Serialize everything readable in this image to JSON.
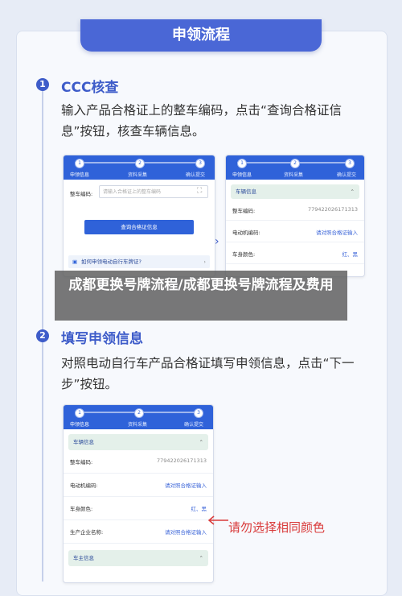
{
  "header": {
    "title": "申领流程"
  },
  "steps": [
    {
      "num": "1",
      "title": "CCC核查",
      "desc": "输入产品合格证上的整车编码，点击“查询合格证信息”按钮，核查车辆信息。"
    },
    {
      "num": "2",
      "title": "填写申领信息",
      "desc": "对照电动自行车产品合格证填写申领信息，点击“下一步”按钮。"
    }
  ],
  "progress_labels": [
    "申领信息",
    "资料采集",
    "确认提交"
  ],
  "progress_nums": [
    "1",
    "2",
    "3"
  ],
  "screen1": {
    "vin_label": "整车编码:",
    "vin_placeholder": "请输入合格证上的整车编码",
    "query_button": "查询合格证信息",
    "help_link": "如何申领电动自行车牌证?"
  },
  "screen2": {
    "section_vehicle": "车辆信息",
    "rows": [
      {
        "k": "整车编码:",
        "v": "779422026171313"
      },
      {
        "k": "电动机编码:",
        "v": "请对照合格证输入"
      },
      {
        "k": "车身颜色:",
        "v": "红、黑"
      }
    ]
  },
  "screen3": {
    "section_vehicle": "车辆信息",
    "rows": [
      {
        "k": "整车编码:",
        "v": "779422026171313"
      },
      {
        "k": "电动机编码:",
        "v": "请对照合格证输入"
      },
      {
        "k": "车身颜色:",
        "v": "红、黑"
      },
      {
        "k": "生产企业名称:",
        "v": "请对照合格证输入"
      }
    ],
    "section_owner": "车主信息"
  },
  "overlay_title": "成都更换号牌流程/成都更换号牌流程及费用",
  "annotation": "请勿选择相同颜色",
  "colors": {
    "accent": "#3e5cc9",
    "header": "#2f62d9",
    "warning": "#d93a3a"
  }
}
